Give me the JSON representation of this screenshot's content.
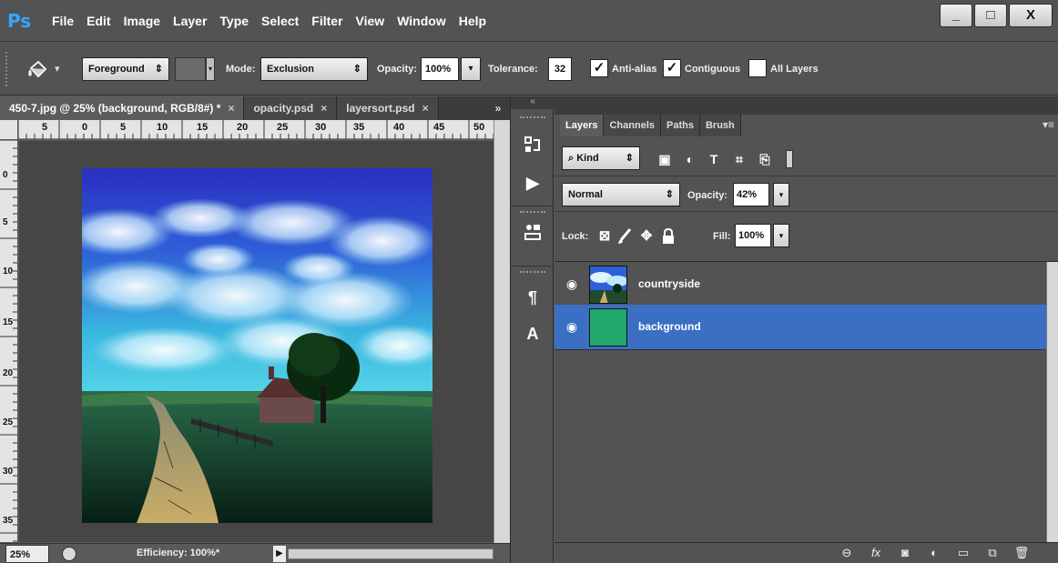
{
  "app": {
    "logo": "Ps",
    "menu": [
      "File",
      "Edit",
      "Image",
      "Layer",
      "Type",
      "Select",
      "Filter",
      "View",
      "Window",
      "Help"
    ],
    "window_controls": {
      "minimize": "_",
      "maximize": "□",
      "close": "X"
    }
  },
  "options_bar": {
    "fill_source": "Foreground",
    "mode_label": "Mode:",
    "mode_value": "Exclusion",
    "opacity_label": "Opacity:",
    "opacity_value": "100%",
    "tolerance_label": "Tolerance:",
    "tolerance_value": "32",
    "anti_alias_label": "Anti-alias",
    "anti_alias_checked": true,
    "contiguous_label": "Contiguous",
    "contiguous_checked": true,
    "all_layers_label": "All Layers",
    "all_layers_checked": false
  },
  "document": {
    "tabs": [
      {
        "label": "450-7.jpg @ 25% (background, RGB/8#) *",
        "active": true
      },
      {
        "label": "opacity.psd",
        "active": false
      },
      {
        "label": "layersort.psd",
        "active": false
      }
    ],
    "tabs_more": "»",
    "ruler_h": [
      "5",
      "0",
      "5",
      "10",
      "15",
      "20",
      "25",
      "30",
      "35",
      "40",
      "45",
      "50"
    ],
    "ruler_v": [
      "0",
      "5",
      "10",
      "15",
      "20",
      "25",
      "30",
      "35"
    ],
    "status": {
      "zoom": "25%",
      "text": "Efficiency: 100%*"
    }
  },
  "panel": {
    "tabs": [
      {
        "label": "Layers",
        "active": true
      },
      {
        "label": "Channels",
        "active": false
      },
      {
        "label": "Paths",
        "active": false
      },
      {
        "label": "Brush",
        "active": false
      }
    ],
    "filter_kind": "Kind",
    "blend_mode": "Normal",
    "opacity_label": "Opacity:",
    "opacity_value": "42%",
    "lock_label": "Lock:",
    "fill_label": "Fill:",
    "fill_value": "100%",
    "layers": [
      {
        "name": "countryside",
        "visible": true,
        "selected": false
      },
      {
        "name": "background",
        "visible": true,
        "selected": true,
        "color": "#1fa86a"
      }
    ]
  },
  "colors": {
    "accent_selected_layer": "#3a6fc4",
    "ps_logo": "#31a8ff",
    "background_layer_fill": "#1fa86a"
  }
}
